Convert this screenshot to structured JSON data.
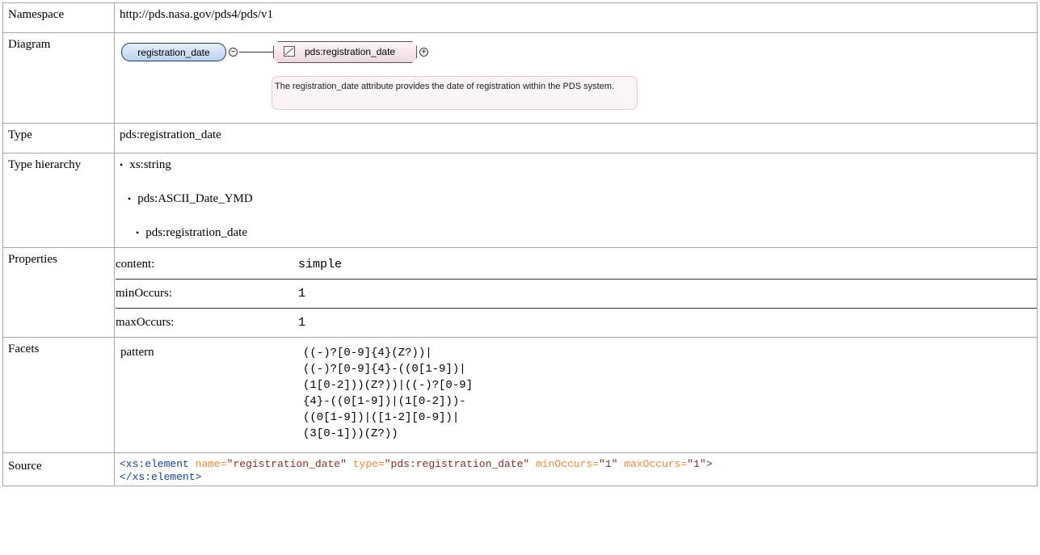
{
  "rows": {
    "namespace": {
      "label": "Namespace",
      "value": "http://pds.nasa.gov/pds4/pds/v1"
    },
    "diagram": {
      "label": "Diagram",
      "element_name": "registration_date",
      "type_name": "pds:registration_date",
      "note": "The registration_date attribute provides the date of registration within the PDS system."
    },
    "type": {
      "label": "Type",
      "value": "pds:registration_date"
    },
    "hierarchy": {
      "label": "Type hierarchy",
      "items": [
        "xs:string",
        "pds:ASCII_Date_YMD",
        "pds:registration_date"
      ]
    },
    "properties": {
      "label": "Properties",
      "items": [
        {
          "key": "content:",
          "value": "simple"
        },
        {
          "key": "minOccurs:",
          "value": "1"
        },
        {
          "key": "maxOccurs:",
          "value": "1"
        }
      ]
    },
    "facets": {
      "label": "Facets",
      "key": "pattern",
      "value": "((-)?[0-9]{4}(Z?))|\n((-)?[0-9]{4}-((0[1-9])|\n(1[0-2]))(Z?))|((-)?[0-9]\n{4}-((0[1-9])|(1[0-2]))-\n((0[1-9])|([1-2][0-9])|\n(3[0-1]))(Z?))"
    },
    "source": {
      "label": "Source",
      "open_tag": "<xs:element",
      "attrs": [
        {
          "name": "name",
          "value": "\"registration_date\""
        },
        {
          "name": "type",
          "value": "\"pds:registration_date\""
        },
        {
          "name": "minOccurs",
          "value": "\"1\""
        },
        {
          "name": "maxOccurs",
          "value": "\"1\""
        }
      ],
      "open_end": ">",
      "close_tag": "</xs:element>"
    }
  },
  "colors": {
    "tag": "#1a40a0",
    "attr": "#f08a3a",
    "value": "#8a2a2a",
    "border": "#a6a6a6"
  },
  "icons": {
    "collapse": "minus-circle-icon",
    "expand": "plus-circle-icon",
    "simple_type": "simple-type-icon"
  }
}
